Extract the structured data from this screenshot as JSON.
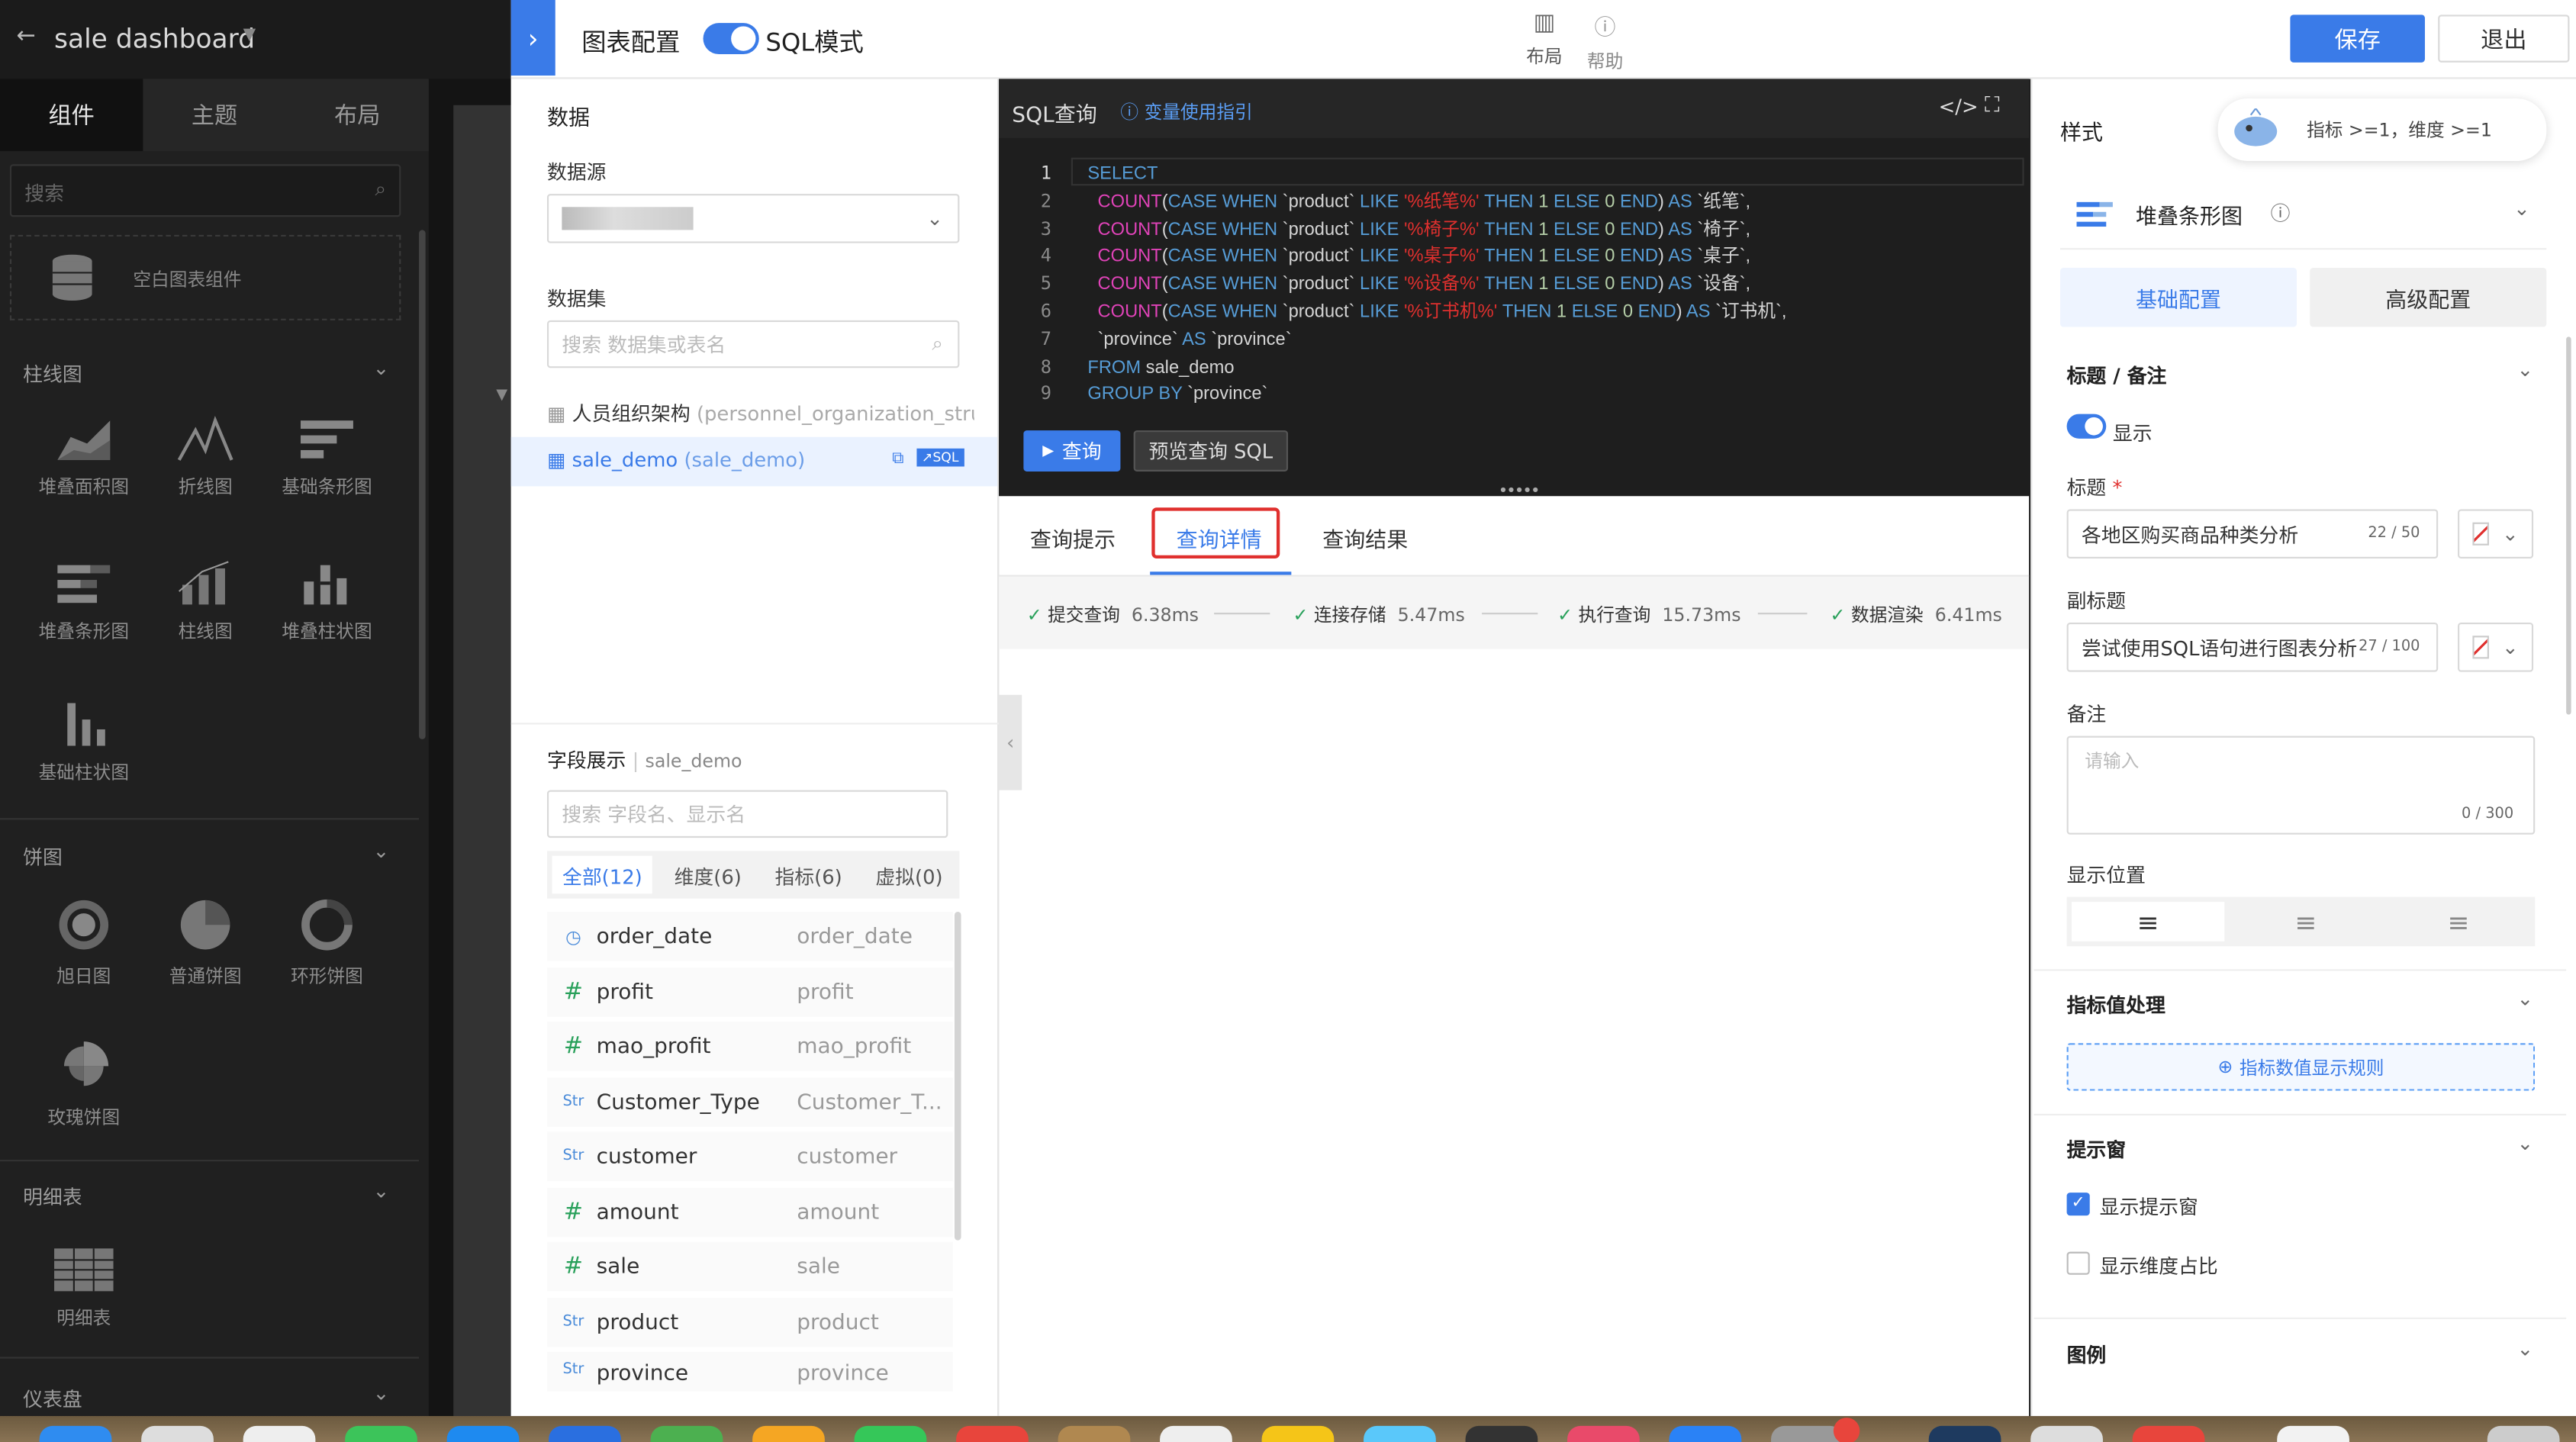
{
  "app": {
    "title": "sale dashboard"
  },
  "sidebar": {
    "tabs": [
      "组件",
      "主题",
      "布局"
    ],
    "search_placeholder": "搜索",
    "blank_label": "空白图表组件",
    "sections": [
      {
        "title": "柱线图"
      },
      {
        "title": "饼图"
      },
      {
        "title": "明细表"
      },
      {
        "title": "仪表盘"
      }
    ],
    "charts1": [
      "堆叠面积图",
      "折线图",
      "基础条形图",
      "堆叠条形图",
      "柱线图",
      "堆叠柱状图",
      "基础柱状图"
    ],
    "charts2": [
      "旭日图",
      "普通饼图",
      "环形饼图",
      "玫瑰饼图"
    ],
    "charts3": [
      "明细表"
    ]
  },
  "topbar": {
    "title": "图表配置",
    "sql_mode": "SQL模式",
    "layout": "布局",
    "help": "帮助",
    "save": "保存",
    "exit": "退出"
  },
  "data": {
    "title": "数据",
    "source_label": "数据源",
    "dataset_label": "数据集",
    "dataset_placeholder": "搜索 数据集或表名",
    "datasets": [
      {
        "name": "人员组织架构",
        "code": "(personnel_organization_stru..."
      },
      {
        "name": "sale_demo",
        "code": "(sale_demo)",
        "badge": "SQL"
      }
    ],
    "fields_title": "字段展示",
    "fields_ds": "sale_demo",
    "fields_placeholder": "搜索 字段名、显示名",
    "field_tabs": [
      "全部(12)",
      "维度(6)",
      "指标(6)",
      "虚拟(0)"
    ],
    "fields": [
      {
        "icon": "clock",
        "name": "order_date",
        "display": "order_date"
      },
      {
        "icon": "#",
        "name": "profit",
        "display": "profit"
      },
      {
        "icon": "#",
        "name": "mao_profit",
        "display": "mao_profit"
      },
      {
        "icon": "Str",
        "name": "Customer_Type",
        "display": "Customer_T..."
      },
      {
        "icon": "Str",
        "name": "customer",
        "display": "customer"
      },
      {
        "icon": "#",
        "name": "amount",
        "display": "amount"
      },
      {
        "icon": "#",
        "name": "sale",
        "display": "sale"
      },
      {
        "icon": "Str",
        "name": "product",
        "display": "product"
      },
      {
        "icon": "Str",
        "name": "province",
        "display": "province"
      }
    ]
  },
  "sql": {
    "title": "SQL查询",
    "guide": "变量使用指引",
    "run": "查询",
    "preview": "预览查询 SQL",
    "lines": [
      "1",
      "2",
      "3",
      "4",
      "5",
      "6",
      "7",
      "8",
      "9"
    ]
  },
  "query": {
    "tabs": [
      "查询提示",
      "查询详情",
      "查询结果"
    ],
    "steps": [
      {
        "label": "提交查询",
        "time": "6.38ms"
      },
      {
        "label": "连接存储",
        "time": "5.47ms"
      },
      {
        "label": "执行查询",
        "time": "15.73ms"
      },
      {
        "label": "数据渲染",
        "time": "6.41ms"
      }
    ]
  },
  "style": {
    "title": "样式",
    "hint": "指标 >=1，维度 >=1",
    "chart_type": "堆叠条形图",
    "tabs": [
      "基础配置",
      "高级配置"
    ],
    "title_section": "标题 / 备注",
    "show": "显示",
    "title_label": "标题",
    "title_value": "各地区购买商品种类分析",
    "title_count": "22 / 50",
    "subtitle_label": "副标题",
    "subtitle_value": "尝试使用SQL语句进行图表分析",
    "subtitle_count": "27 / 100",
    "note_label": "备注",
    "note_placeholder": "请输入",
    "note_count": "0 / 300",
    "position_label": "显示位置",
    "metric_section": "指标值处理",
    "metric_rule": "指标数值显示规则",
    "tooltip_section": "提示窗",
    "show_tooltip": "显示提示窗",
    "show_dim_ratio": "显示维度占比",
    "legend_section": "图例"
  },
  "colors": {
    "accent": "#3a7be8",
    "highlight": "#e0302e"
  }
}
